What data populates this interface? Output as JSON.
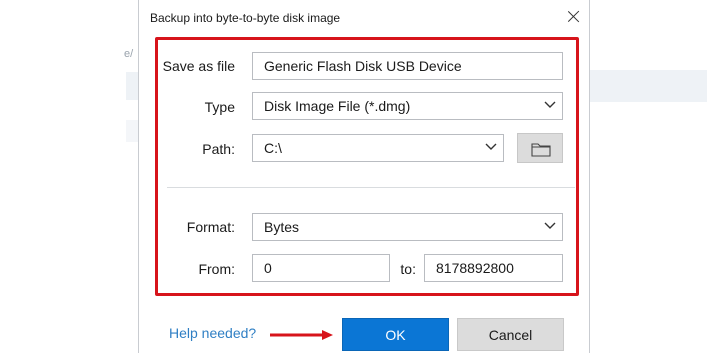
{
  "dialog": {
    "title": "Backup into byte-to-byte disk image",
    "close_icon": "close-icon"
  },
  "form": {
    "save_as": {
      "label": "Save as file",
      "value": "Generic Flash Disk USB Device"
    },
    "type": {
      "label": "Type",
      "value": "Disk Image File (*.dmg)"
    },
    "path": {
      "label": "Path:",
      "value": "C:\\",
      "browse_icon": "folder-icon"
    },
    "format": {
      "label": "Format:",
      "value": "Bytes"
    },
    "from": {
      "label": "From:",
      "value": "0"
    },
    "to": {
      "label": "to:",
      "value": "8178892800"
    }
  },
  "footer": {
    "help_link": "Help needed?",
    "ok_label": "OK",
    "cancel_label": "Cancel"
  },
  "background": {
    "fragment": "e/"
  },
  "colors": {
    "highlight": "#d7141b",
    "accent": "#0b76d5",
    "link": "#2f7fc4"
  }
}
